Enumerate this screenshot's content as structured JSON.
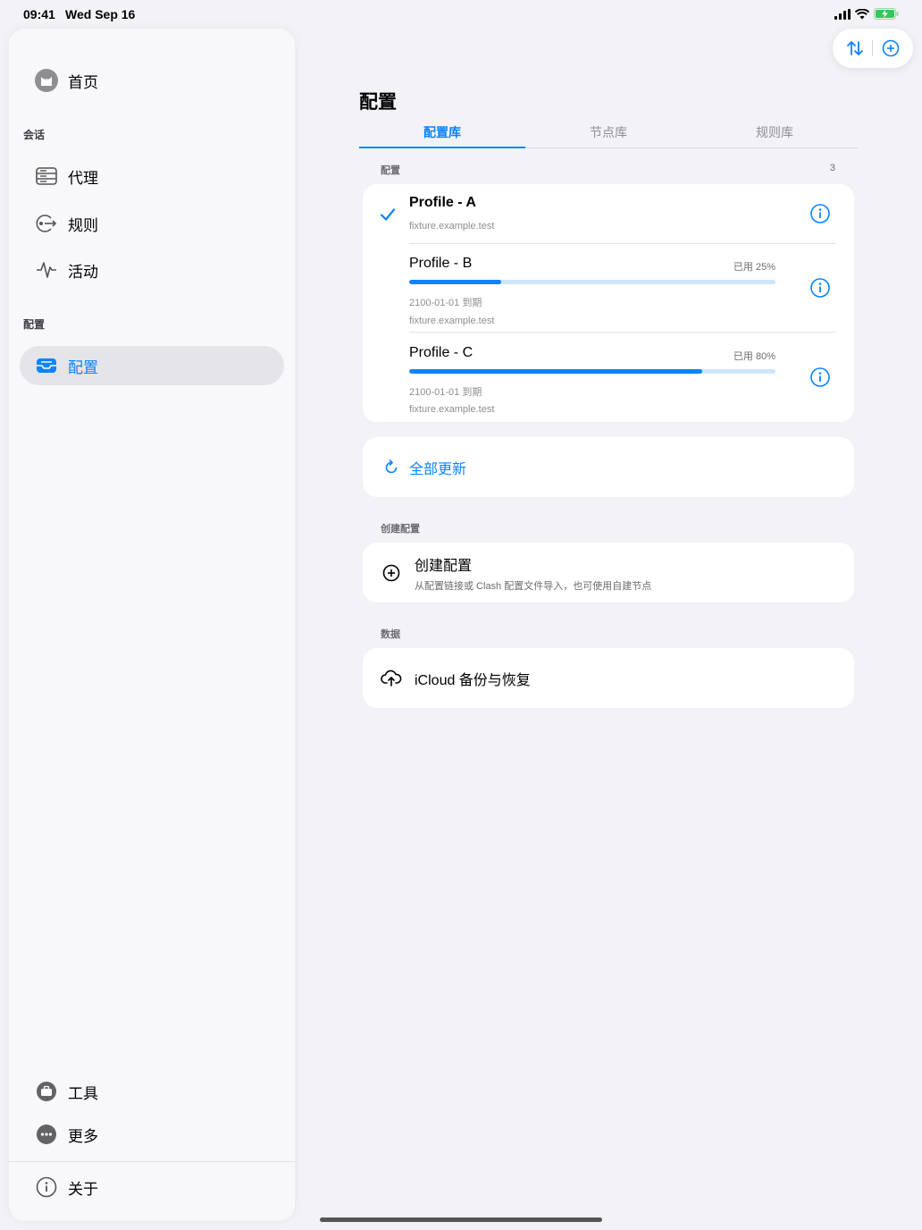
{
  "status": {
    "time": "09:41",
    "date": "Wed Sep 16"
  },
  "sidebar": {
    "home": "首页",
    "section_session": "会话",
    "proxy": "代理",
    "rules": "规则",
    "activity": "活动",
    "section_config": "配置",
    "config": "配置",
    "tools": "工具",
    "more": "更多",
    "about": "关于"
  },
  "main": {
    "title": "配置",
    "tabs": [
      {
        "label": "配置库"
      },
      {
        "label": "节点库"
      },
      {
        "label": "规则库"
      }
    ],
    "profiles_section": {
      "label": "配置",
      "count": "3"
    },
    "profiles": [
      {
        "name": "Profile - A",
        "host": "fixture.example.test",
        "selected": true
      },
      {
        "name": "Profile - B",
        "used": "已用 25%",
        "usage": 0.25,
        "expiry": "2100-01-01 到期",
        "host": "fixture.example.test"
      },
      {
        "name": "Profile - C",
        "used": "已用 80%",
        "usage": 0.8,
        "expiry": "2100-01-01 到期",
        "host": "fixture.example.test"
      }
    ],
    "update_all": "全部更新",
    "create_section": "创建配置",
    "create_title": "创建配置",
    "create_desc": "从配置链接或 Clash 配置文件导入，也可使用自建节点",
    "data_section": "数据",
    "icloud": "iCloud 备份与恢复"
  },
  "colors": {
    "accent": "#0a84ff",
    "bar_track": "#cfe6fa",
    "background": "#f2f2f7"
  }
}
